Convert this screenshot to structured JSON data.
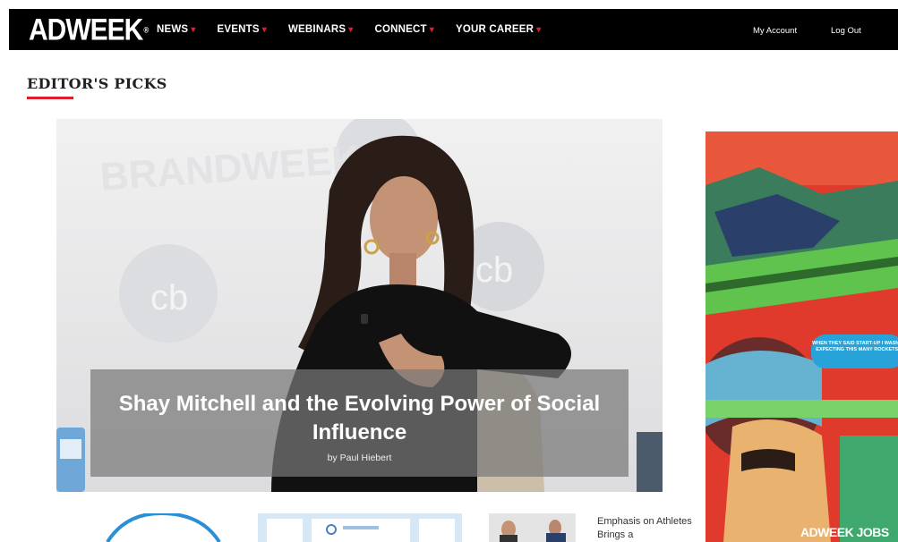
{
  "header": {
    "logo": "ADWEEK",
    "nav": [
      {
        "label": "NEWS"
      },
      {
        "label": "EVENTS"
      },
      {
        "label": "WEBINARS"
      },
      {
        "label": "CONNECT"
      },
      {
        "label": "YOUR CAREER"
      }
    ],
    "my_account": "My Account",
    "log_out": "Log Out"
  },
  "section": {
    "title": "EDITOR'S PICKS"
  },
  "hero": {
    "headline": "Shay Mitchell and the Evolving Power of Social Influence",
    "byline": "by Paul Hiebert",
    "backdrop_text": "BRANDWEEK",
    "backdrop_logo": "cb"
  },
  "side_ad": {
    "bubble_text": "WHEN THEY SAID START-UP I WASN'T EXPECTING THIS MANY ROCKETS.",
    "logo": "ADWEEK JOBS"
  },
  "cards": {
    "third_title": "Emphasis on Athletes Brings a"
  },
  "colors": {
    "accent": "#e01e2b",
    "navbar": "#000000"
  }
}
